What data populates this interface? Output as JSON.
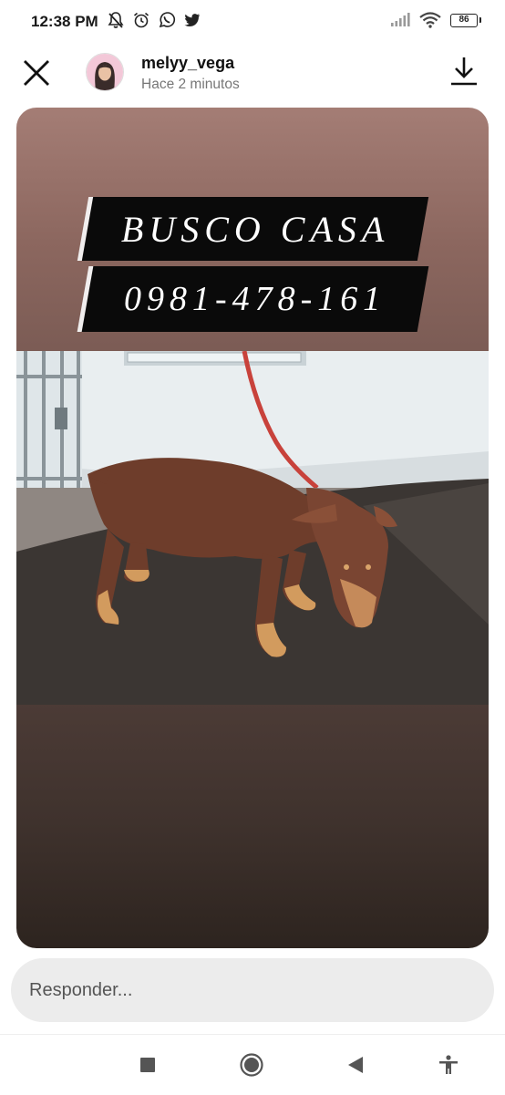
{
  "status_bar": {
    "time": "12:38 PM",
    "battery": "86",
    "left_icons": [
      "notifications-off-icon",
      "alarm-icon",
      "whatsapp-icon",
      "twitter-icon"
    ],
    "right_icons": [
      "signal-icon",
      "wifi-icon",
      "battery-icon"
    ]
  },
  "header": {
    "username": "melyy_vega",
    "timestamp": "Hace 2 minutos",
    "close_icon": "close-icon",
    "download_icon": "download-icon"
  },
  "story": {
    "line1": "BUSCO CASA",
    "line2": "0981-478-161",
    "photo_subject": "dog",
    "gradient_top": "#a47d75",
    "gradient_bottom": "#2d241f"
  },
  "reply": {
    "placeholder": "Responder..."
  },
  "nav_bar": {
    "items": [
      "recents-icon",
      "home-icon",
      "back-icon",
      "accessibility-icon"
    ]
  }
}
